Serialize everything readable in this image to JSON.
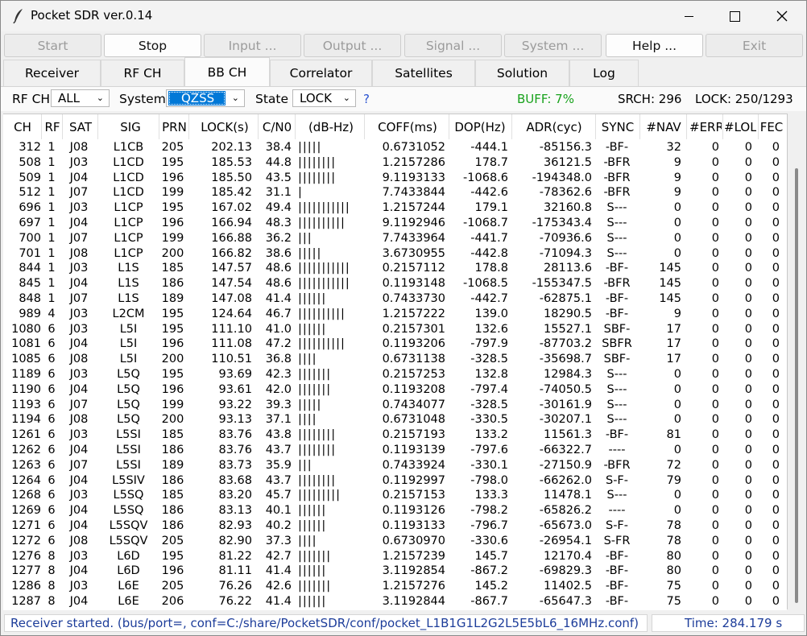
{
  "window": {
    "title": "Pocket SDR ver.0.14",
    "icon": "feather-icon"
  },
  "toolbar": [
    {
      "label": "Start",
      "enabled": false
    },
    {
      "label": "Stop",
      "enabled": true
    },
    {
      "label": "Input ...",
      "enabled": false
    },
    {
      "label": "Output ...",
      "enabled": false
    },
    {
      "label": "Signal ...",
      "enabled": false
    },
    {
      "label": "System ...",
      "enabled": false
    },
    {
      "label": "Help ...",
      "enabled": true
    },
    {
      "label": "Exit",
      "enabled": false
    }
  ],
  "tabs": [
    "Receiver",
    "RF CH",
    "BB CH",
    "Correlator",
    "Satellites",
    "Solution",
    "Log"
  ],
  "active_tab": "BB CH",
  "filter": {
    "rfch_label": "RF CH",
    "rfch_value": "ALL",
    "system_label": "System",
    "system_value": "QZSS",
    "state_label": "State",
    "state_value": "LOCK",
    "help": "?",
    "buff": "BUFF:  7%",
    "srch": "SRCH: 296",
    "lock": "LOCK: 250/1293"
  },
  "colors": {
    "buff": "#18a21c",
    "status_text": "#1d3d9a",
    "selection": "#0078d7",
    "help": "#2a52d1"
  },
  "columns": [
    "CH",
    "RF",
    "SAT",
    "SIG",
    "PRN",
    "LOCK(s)",
    "C/N0",
    "(dB-Hz)",
    "COFF(ms)",
    "DOP(Hz)",
    "ADR(cyc)",
    "SYNC",
    "#NAV",
    "#ERR",
    "#LOL",
    "FEC"
  ],
  "rows": [
    [
      "312",
      "1",
      "J08",
      "L1CB",
      "205",
      "202.13",
      "38.4",
      "|||||",
      "0.6731052",
      "-444.1",
      "-85156.3",
      "-BF-",
      "32",
      "0",
      "0",
      "0"
    ],
    [
      "508",
      "1",
      "J03",
      "L1CD",
      "195",
      "185.53",
      "44.8",
      "||||||||",
      "1.2157286",
      "178.7",
      "36121.5",
      "-BFR",
      "9",
      "0",
      "0",
      "0"
    ],
    [
      "509",
      "1",
      "J04",
      "L1CD",
      "196",
      "185.50",
      "43.5",
      "||||||||",
      "9.1193133",
      "-1068.6",
      "-194348.0",
      "-BFR",
      "9",
      "0",
      "0",
      "0"
    ],
    [
      "512",
      "1",
      "J07",
      "L1CD",
      "199",
      "185.42",
      "31.1",
      "|",
      "7.7433844",
      "-442.6",
      "-78362.6",
      "-BFR",
      "9",
      "0",
      "0",
      "0"
    ],
    [
      "696",
      "1",
      "J03",
      "L1CP",
      "195",
      "167.02",
      "49.4",
      "|||||||||||",
      "1.2157244",
      "179.1",
      "32160.8",
      "S---",
      "0",
      "0",
      "0",
      "0"
    ],
    [
      "697",
      "1",
      "J04",
      "L1CP",
      "196",
      "166.94",
      "48.3",
      "||||||||||",
      "9.1192946",
      "-1068.7",
      "-175343.4",
      "S---",
      "0",
      "0",
      "0",
      "0"
    ],
    [
      "700",
      "1",
      "J07",
      "L1CP",
      "199",
      "166.88",
      "36.2",
      "|||",
      "7.7433964",
      "-441.7",
      "-70936.6",
      "S---",
      "0",
      "0",
      "0",
      "0"
    ],
    [
      "701",
      "1",
      "J08",
      "L1CP",
      "200",
      "166.82",
      "38.6",
      "|||||",
      "3.6730955",
      "-442.8",
      "-71094.3",
      "S---",
      "0",
      "0",
      "0",
      "0"
    ],
    [
      "844",
      "1",
      "J03",
      "L1S",
      "185",
      "147.57",
      "48.6",
      "|||||||||||",
      "0.2157112",
      "178.8",
      "28113.6",
      "-BF-",
      "145",
      "0",
      "0",
      "0"
    ],
    [
      "845",
      "1",
      "J04",
      "L1S",
      "186",
      "147.54",
      "48.6",
      "|||||||||||",
      "0.1193148",
      "-1068.5",
      "-155347.5",
      "-BFR",
      "145",
      "0",
      "0",
      "0"
    ],
    [
      "848",
      "1",
      "J07",
      "L1S",
      "189",
      "147.08",
      "41.4",
      "||||||",
      "0.7433730",
      "-442.7",
      "-62875.1",
      "-BF-",
      "145",
      "0",
      "0",
      "0"
    ],
    [
      "989",
      "4",
      "J03",
      "L2CM",
      "195",
      "124.64",
      "46.7",
      "||||||||||",
      "1.2157222",
      "139.0",
      "18290.5",
      "-BF-",
      "9",
      "0",
      "0",
      "0"
    ],
    [
      "1080",
      "6",
      "J03",
      "L5I",
      "195",
      "111.10",
      "41.0",
      "||||||",
      "0.2157301",
      "132.6",
      "15527.1",
      "SBF-",
      "17",
      "0",
      "0",
      "0"
    ],
    [
      "1081",
      "6",
      "J04",
      "L5I",
      "196",
      "111.08",
      "47.2",
      "||||||||||",
      "0.1193206",
      "-797.9",
      "-87703.2",
      "SBFR",
      "17",
      "0",
      "0",
      "0"
    ],
    [
      "1085",
      "6",
      "J08",
      "L5I",
      "200",
      "110.51",
      "36.8",
      "||||",
      "0.6731138",
      "-328.5",
      "-35698.7",
      "SBF-",
      "17",
      "0",
      "0",
      "0"
    ],
    [
      "1189",
      "6",
      "J03",
      "L5Q",
      "195",
      "93.69",
      "42.3",
      "|||||||",
      "0.2157253",
      "132.8",
      "12984.3",
      "S---",
      "0",
      "0",
      "0",
      "0"
    ],
    [
      "1190",
      "6",
      "J04",
      "L5Q",
      "196",
      "93.61",
      "42.0",
      "|||||||",
      "0.1193208",
      "-797.4",
      "-74050.5",
      "S---",
      "0",
      "0",
      "0",
      "0"
    ],
    [
      "1193",
      "6",
      "J07",
      "L5Q",
      "199",
      "93.22",
      "39.3",
      "|||||",
      "0.7434077",
      "-328.5",
      "-30161.9",
      "S---",
      "0",
      "0",
      "0",
      "0"
    ],
    [
      "1194",
      "6",
      "J08",
      "L5Q",
      "200",
      "93.13",
      "37.1",
      "||||",
      "0.6731048",
      "-330.5",
      "-30207.1",
      "S---",
      "0",
      "0",
      "0",
      "0"
    ],
    [
      "1261",
      "6",
      "J03",
      "L5SI",
      "185",
      "83.76",
      "43.8",
      "||||||||",
      "0.2157193",
      "133.2",
      "11561.3",
      "-BF-",
      "81",
      "0",
      "0",
      "0"
    ],
    [
      "1262",
      "6",
      "J04",
      "L5SI",
      "186",
      "83.76",
      "43.7",
      "||||||||",
      "0.1193139",
      "-797.6",
      "-66322.7",
      "----",
      "0",
      "0",
      "0",
      "0"
    ],
    [
      "1263",
      "6",
      "J07",
      "L5SI",
      "189",
      "83.73",
      "35.9",
      "|||",
      "0.7433924",
      "-330.1",
      "-27150.9",
      "-BFR",
      "72",
      "0",
      "0",
      "0"
    ],
    [
      "1264",
      "6",
      "J04",
      "L5SIV",
      "186",
      "83.68",
      "43.7",
      "||||||||",
      "0.1192997",
      "-798.0",
      "-66262.0",
      "S-F-",
      "79",
      "0",
      "0",
      "0"
    ],
    [
      "1268",
      "6",
      "J03",
      "L5SQ",
      "185",
      "83.20",
      "45.7",
      "|||||||||",
      "0.2157153",
      "133.3",
      "11478.1",
      "S---",
      "0",
      "0",
      "0",
      "0"
    ],
    [
      "1269",
      "6",
      "J04",
      "L5SQ",
      "186",
      "83.13",
      "40.1",
      "||||||",
      "0.1193126",
      "-798.2",
      "-65826.2",
      "----",
      "0",
      "0",
      "0",
      "0"
    ],
    [
      "1271",
      "6",
      "J04",
      "L5SQV",
      "186",
      "82.93",
      "40.2",
      "||||||",
      "0.1193133",
      "-796.7",
      "-65673.0",
      "S-F-",
      "78",
      "0",
      "0",
      "0"
    ],
    [
      "1272",
      "6",
      "J08",
      "L5SQV",
      "205",
      "82.90",
      "37.3",
      "||||",
      "0.6730970",
      "-330.6",
      "-26954.1",
      "S-FR",
      "78",
      "0",
      "0",
      "0"
    ],
    [
      "1276",
      "8",
      "J03",
      "L6D",
      "195",
      "81.22",
      "42.7",
      "|||||||",
      "1.2157239",
      "145.7",
      "12170.4",
      "-BF-",
      "80",
      "0",
      "0",
      "0"
    ],
    [
      "1277",
      "8",
      "J04",
      "L6D",
      "196",
      "81.11",
      "41.4",
      "||||||",
      "3.1192854",
      "-867.2",
      "-69829.3",
      "-BF-",
      "80",
      "0",
      "0",
      "0"
    ],
    [
      "1286",
      "8",
      "J03",
      "L6E",
      "205",
      "76.26",
      "42.6",
      "|||||||",
      "1.2157276",
      "145.2",
      "11402.5",
      "-BF-",
      "75",
      "0",
      "0",
      "0"
    ],
    [
      "1287",
      "8",
      "J04",
      "L6E",
      "206",
      "76.22",
      "41.4",
      "||||||",
      "3.1192844",
      "-867.7",
      "-65647.3",
      "-BF-",
      "75",
      "0",
      "0",
      "0"
    ]
  ],
  "status": {
    "message": "Receiver started. (bus/port=, conf=C:/share/PocketSDR/conf/pocket_L1B1G1L2G2L5E5bL6_16MHz.conf)",
    "time": "Time: 284.179 s"
  }
}
